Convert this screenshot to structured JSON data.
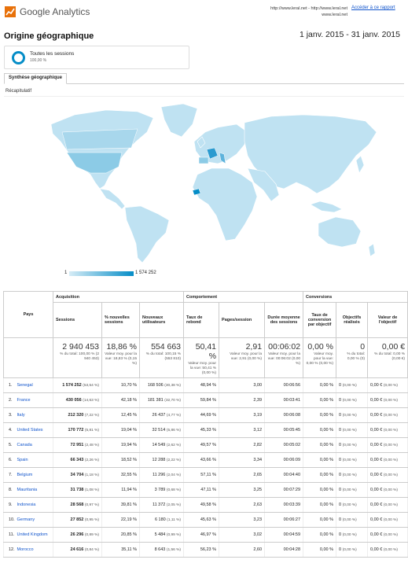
{
  "header": {
    "logo_text": "Google Analytics",
    "url_line1": "http://www.leral.net - http://www.leral.net",
    "url_line2": "www.leral.net",
    "report_link": "Accéder à ce rapport"
  },
  "page": {
    "title": "Origine géographique",
    "date_range": "1 janv. 2015 - 31 janv. 2015"
  },
  "segment": {
    "name": "Toutes les sessions",
    "pct": "100,00 %",
    "color": "#058dc7"
  },
  "tabs": {
    "active": "Synthèse géographique",
    "recap": "Récapitulatif"
  },
  "map": {
    "legend_min": "1",
    "legend_max": "1 574 252",
    "color_low": "#d6ecf6",
    "color_high": "#058dc7"
  },
  "table": {
    "groups": {
      "pays": "Pays",
      "acquisition": "Acquisition",
      "comportement": "Comportement",
      "conversions": "Conversions"
    },
    "columns": {
      "sessions": "Sessions",
      "new_sessions": "% nouvelles sessions",
      "new_users": "Nouveaux utilisateurs",
      "bounce": "Taux de rebond",
      "pages": "Pages/session",
      "duration": "Durée moyenne des sessions",
      "conv_rate": "Taux de conversion par objectif",
      "goals": "Objectifs réalisés",
      "goal_value": "Valeur de l'objectif"
    },
    "totals": {
      "sessions": "2 940 453",
      "sessions_sub": "% du total: 100,00 % (2 940 453)",
      "new_sessions": "18,86 %",
      "new_sessions_sub": "Valeur moy. pour la vue: 18,83 % (0,15 %)",
      "new_users": "554 663",
      "new_users_sub": "% du total: 100,15 % (553 810)",
      "bounce": "50,41 %",
      "bounce_sub": "Valeur moy. pour la vue: 50,41 % (0,00 %)",
      "pages": "2,91",
      "pages_sub": "Valeur moy. pour la vue: 2,91 (0,00 %)",
      "duration": "00:06:02",
      "duration_sub": "Valeur moy. pour la vue: 00:06:02 (0,00 %)",
      "conv_rate": "0,00 %",
      "conv_rate_sub": "Valeur moy. pour la vue: 0,00 % (0,00 %)",
      "goals": "0",
      "goals_sub": "% du total: 0,00 % (0)",
      "goal_value": "0,00 €",
      "goal_value_sub": "% du total: 0,00 % (0,00 €)"
    },
    "rows": [
      {
        "idx": "1.",
        "country": "Senegal",
        "sessions": "1 574 252",
        "sessions_pct": "(53,54 %)",
        "new_sessions": "10,70 %",
        "new_users": "168 506",
        "new_users_pct": "(30,38 %)",
        "bounce": "48,94 %",
        "pages": "3,00",
        "duration": "00:06:56",
        "conv": "0,00 %",
        "goals": "0",
        "goals_pct": "(0,00 %)",
        "value": "0,00 €",
        "value_pct": "(0,00 %)"
      },
      {
        "idx": "2.",
        "country": "France",
        "sessions": "430 056",
        "sessions_pct": "(14,63 %)",
        "new_sessions": "42,18 %",
        "new_users": "181 381",
        "new_users_pct": "(32,70 %)",
        "bounce": "59,84 %",
        "pages": "2,39",
        "duration": "00:03:41",
        "conv": "0,00 %",
        "goals": "0",
        "goals_pct": "(0,00 %)",
        "value": "0,00 €",
        "value_pct": "(0,00 %)"
      },
      {
        "idx": "3.",
        "country": "Italy",
        "sessions": "212 320",
        "sessions_pct": "(7,22 %)",
        "new_sessions": "12,45 %",
        "new_users": "26 437",
        "new_users_pct": "(4,77 %)",
        "bounce": "44,69 %",
        "pages": "3,19",
        "duration": "00:06:08",
        "conv": "0,00 %",
        "goals": "0",
        "goals_pct": "(0,00 %)",
        "value": "0,00 €",
        "value_pct": "(0,00 %)"
      },
      {
        "idx": "4.",
        "country": "United States",
        "sessions": "170 772",
        "sessions_pct": "(5,81 %)",
        "new_sessions": "19,04 %",
        "new_users": "32 514",
        "new_users_pct": "(5,86 %)",
        "bounce": "45,33 %",
        "pages": "3,12",
        "duration": "00:05:45",
        "conv": "0,00 %",
        "goals": "0",
        "goals_pct": "(0,00 %)",
        "value": "0,00 €",
        "value_pct": "(0,00 %)"
      },
      {
        "idx": "5.",
        "country": "Canada",
        "sessions": "72 951",
        "sessions_pct": "(2,48 %)",
        "new_sessions": "19,94 %",
        "new_users": "14 549",
        "new_users_pct": "(2,62 %)",
        "bounce": "49,57 %",
        "pages": "2,82",
        "duration": "00:05:02",
        "conv": "0,00 %",
        "goals": "0",
        "goals_pct": "(0,00 %)",
        "value": "0,00 €",
        "value_pct": "(0,00 %)"
      },
      {
        "idx": "6.",
        "country": "Spain",
        "sessions": "66 343",
        "sessions_pct": "(2,26 %)",
        "new_sessions": "18,52 %",
        "new_users": "12 288",
        "new_users_pct": "(2,22 %)",
        "bounce": "43,66 %",
        "pages": "3,34",
        "duration": "00:06:09",
        "conv": "0,00 %",
        "goals": "0",
        "goals_pct": "(0,00 %)",
        "value": "0,00 €",
        "value_pct": "(0,00 %)"
      },
      {
        "idx": "7.",
        "country": "Belgium",
        "sessions": "34 704",
        "sessions_pct": "(1,18 %)",
        "new_sessions": "32,55 %",
        "new_users": "11 296",
        "new_users_pct": "(2,04 %)",
        "bounce": "57,11 %",
        "pages": "2,65",
        "duration": "00:04:40",
        "conv": "0,00 %",
        "goals": "0",
        "goals_pct": "(0,00 %)",
        "value": "0,00 €",
        "value_pct": "(0,00 %)"
      },
      {
        "idx": "8.",
        "country": "Mauritania",
        "sessions": "31 738",
        "sessions_pct": "(1,08 %)",
        "new_sessions": "11,94 %",
        "new_users": "3 789",
        "new_users_pct": "(0,68 %)",
        "bounce": "47,11 %",
        "pages": "3,25",
        "duration": "00:07:29",
        "conv": "0,00 %",
        "goals": "0",
        "goals_pct": "(0,00 %)",
        "value": "0,00 €",
        "value_pct": "(0,00 %)"
      },
      {
        "idx": "9.",
        "country": "Indonesia",
        "sessions": "28 568",
        "sessions_pct": "(0,97 %)",
        "new_sessions": "39,81 %",
        "new_users": "11 372",
        "new_users_pct": "(2,05 %)",
        "bounce": "49,58 %",
        "pages": "2,63",
        "duration": "00:03:39",
        "conv": "0,00 %",
        "goals": "0",
        "goals_pct": "(0,00 %)",
        "value": "0,00 €",
        "value_pct": "(0,00 %)"
      },
      {
        "idx": "10.",
        "country": "Germany",
        "sessions": "27 852",
        "sessions_pct": "(0,95 %)",
        "new_sessions": "22,19 %",
        "new_users": "6 180",
        "new_users_pct": "(1,11 %)",
        "bounce": "45,63 %",
        "pages": "3,23",
        "duration": "00:06:27",
        "conv": "0,00 %",
        "goals": "0",
        "goals_pct": "(0,00 %)",
        "value": "0,00 €",
        "value_pct": "(0,00 %)"
      },
      {
        "idx": "11.",
        "country": "United Kingdom",
        "sessions": "26 296",
        "sessions_pct": "(0,89 %)",
        "new_sessions": "20,85 %",
        "new_users": "5 484",
        "new_users_pct": "(0,99 %)",
        "bounce": "46,97 %",
        "pages": "3,02",
        "duration": "00:04:59",
        "conv": "0,00 %",
        "goals": "0",
        "goals_pct": "(0,00 %)",
        "value": "0,00 €",
        "value_pct": "(0,00 %)"
      },
      {
        "idx": "12.",
        "country": "Morocco",
        "sessions": "24 616",
        "sessions_pct": "(0,84 %)",
        "new_sessions": "35,11 %",
        "new_users": "8 643",
        "new_users_pct": "(1,56 %)",
        "bounce": "56,23 %",
        "pages": "2,60",
        "duration": "00:04:28",
        "conv": "0,00 %",
        "goals": "0",
        "goals_pct": "(0,00 %)",
        "value": "0,00 €",
        "value_pct": "(0,00 %)"
      }
    ]
  }
}
